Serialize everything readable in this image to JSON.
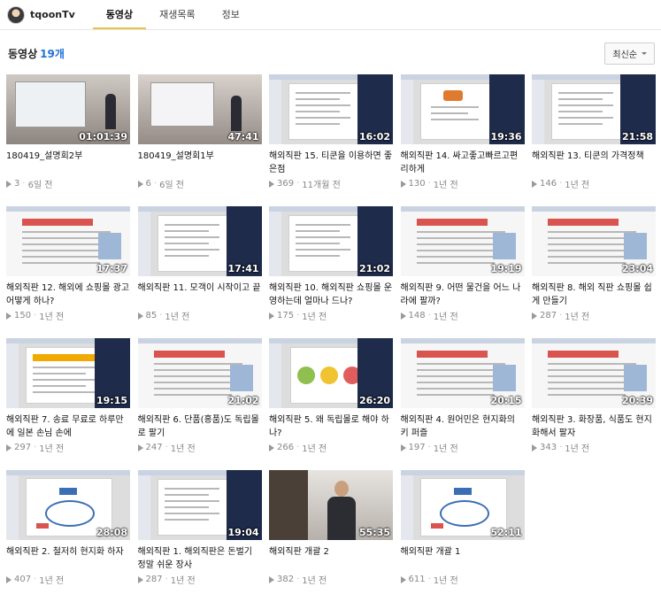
{
  "channel": {
    "name": "tqoonTv"
  },
  "tabs": [
    {
      "label": "동영상",
      "active": true
    },
    {
      "label": "재생목록",
      "active": false
    },
    {
      "label": "정보",
      "active": false
    }
  ],
  "list": {
    "title": "동영상",
    "count": "19개",
    "sort_label": "최신순"
  },
  "videos": [
    {
      "title": "180419_설명회2부",
      "duration": "01:01:39",
      "views": "3",
      "age": "6일 전",
      "style": "room"
    },
    {
      "title": "180419_설명회1부",
      "duration": "47:41",
      "views": "6",
      "age": "6일 전",
      "style": "room2"
    },
    {
      "title": "해외직판 15. 티쿤을 이용하면 좋은점",
      "duration": "16:02",
      "views": "369",
      "age": "11개월 전",
      "style": "slide"
    },
    {
      "title": "해외직판 14. 싸고좋고빠르고편리하게",
      "duration": "19:36",
      "views": "130",
      "age": "1년 전",
      "style": "slide-red"
    },
    {
      "title": "해외직판 13. 티쿤의 가격정책",
      "duration": "21:58",
      "views": "146",
      "age": "1년 전",
      "style": "slide"
    },
    {
      "title": "해외직판 12. 해외에 쇼핑몰 광고 어떻게 하나?",
      "duration": "17:37",
      "views": "150",
      "age": "1년 전",
      "style": "web"
    },
    {
      "title": "해외직판 11. 모객이 시작이고 끝",
      "duration": "17:41",
      "views": "85",
      "age": "1년 전",
      "style": "slide"
    },
    {
      "title": "해외직판 10. 해외직판 쇼핑몰 운영하는데 얼마나 드나?",
      "duration": "21:02",
      "views": "175",
      "age": "1년 전",
      "style": "slide"
    },
    {
      "title": "해외직판 9. 어떤 물건을 어느 나라에 팔까?",
      "duration": "19:19",
      "views": "148",
      "age": "1년 전",
      "style": "web"
    },
    {
      "title": "해외직판 8. 해외 직판 쇼핑몰 쉽게 만들기",
      "duration": "23:04",
      "views": "287",
      "age": "1년 전",
      "style": "web"
    },
    {
      "title": "해외직판 7. 송료 무료로 하루만에 일본 손님 손에",
      "duration": "19:15",
      "views": "297",
      "age": "1년 전",
      "style": "table"
    },
    {
      "title": "해외직판 6. 단품(홍품)도 독립몰로 팔기",
      "duration": "21:02",
      "views": "247",
      "age": "1년 전",
      "style": "web"
    },
    {
      "title": "해외직판 5. 왜 독립몰로 해야 하나?",
      "duration": "26:20",
      "views": "266",
      "age": "1년 전",
      "style": "circles"
    },
    {
      "title": "해외직판 4. 원어민은 현지화의 키 퍼즐",
      "duration": "20:15",
      "views": "197",
      "age": "1년 전",
      "style": "web"
    },
    {
      "title": "해외직판 3. 화장품, 식품도 현지화해서 팔자",
      "duration": "20:39",
      "views": "343",
      "age": "1년 전",
      "style": "web"
    },
    {
      "title": "해외직판 2. 철저히 현지화 하자",
      "duration": "28:08",
      "views": "407",
      "age": "1년 전",
      "style": "diagram"
    },
    {
      "title": "해외직판 1. 해외직판은 돈벌기 정말 쉬운 장사",
      "duration": "19:04",
      "views": "287",
      "age": "1년 전",
      "style": "slide"
    },
    {
      "title": "해외직판 개괄 2",
      "duration": "55:35",
      "views": "382",
      "age": "1년 전",
      "style": "person"
    },
    {
      "title": "해외직판 개괄 1",
      "duration": "52:11",
      "views": "611",
      "age": "1년 전",
      "style": "diagram"
    }
  ],
  "colors": {
    "accent": "#1f73d6",
    "tab_underline": "#e8c34a",
    "banner": "#1e2b4a"
  },
  "icons": {
    "play": "play-icon",
    "caret": "chevron-down-icon"
  }
}
